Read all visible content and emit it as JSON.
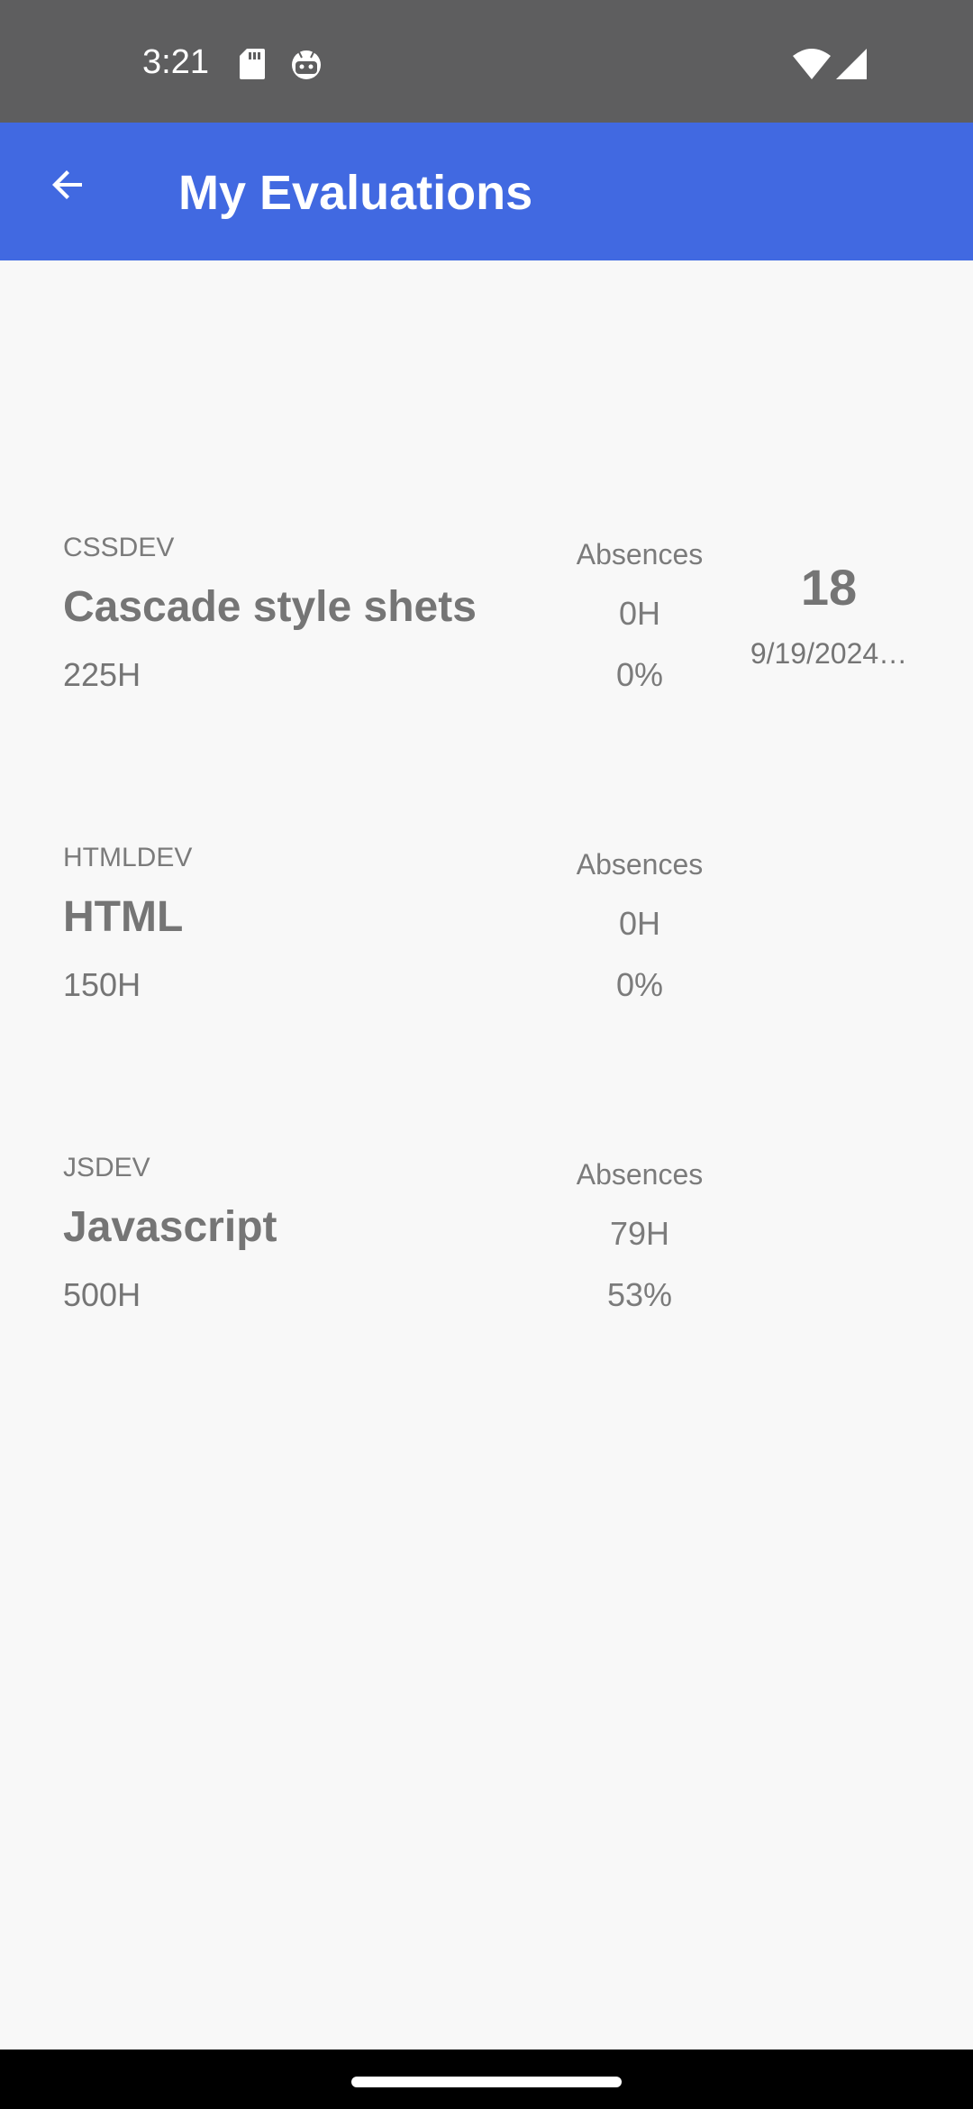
{
  "status_bar": {
    "time": "3:21",
    "left_icons": [
      "sd-card-icon",
      "android-robot-icon"
    ],
    "right_icons": [
      "wifi-icon",
      "cell-signal-icon"
    ]
  },
  "app_bar": {
    "back_icon": "arrow-back-icon",
    "title": "My Evaluations",
    "color": "#4169e1"
  },
  "evaluations": [
    {
      "code": "CSSDEV",
      "name": "Cascade style shets",
      "hours": "225H",
      "absences_label": "Absences",
      "absence_hours": "0H",
      "absence_percent": "0%",
      "grade": "18",
      "date": "9/19/2024…"
    },
    {
      "code": "HTMLDEV",
      "name": "HTML",
      "hours": "150H",
      "absences_label": "Absences",
      "absence_hours": "0H",
      "absence_percent": "0%"
    },
    {
      "code": "JSDEV",
      "name": "Javascript",
      "hours": "500H",
      "absences_label": "Absences",
      "absence_hours": "79H",
      "absence_percent": "53%"
    }
  ]
}
